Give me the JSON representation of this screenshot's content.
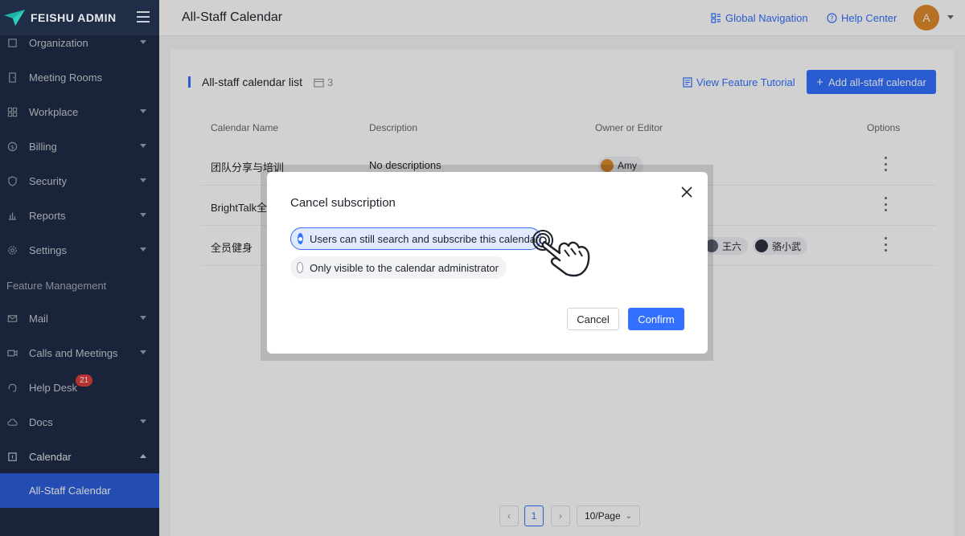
{
  "brand": {
    "name": "FEISHU ADMIN"
  },
  "sidebar": {
    "items": [
      {
        "label": "Organization",
        "icon": "org-icon",
        "expandable": true
      },
      {
        "label": "Meeting Rooms",
        "icon": "door-icon",
        "expandable": false
      },
      {
        "label": "Workplace",
        "icon": "grid-icon",
        "expandable": true
      },
      {
        "label": "Billing",
        "icon": "coin-icon",
        "expandable": true
      },
      {
        "label": "Security",
        "icon": "shield-icon",
        "expandable": true
      },
      {
        "label": "Reports",
        "icon": "bar-chart-icon",
        "expandable": true
      },
      {
        "label": "Settings",
        "icon": "gear-icon",
        "expandable": true
      }
    ],
    "section_label": "Feature Management",
    "feature_items": [
      {
        "label": "Mail",
        "icon": "mail-icon",
        "expandable": true
      },
      {
        "label": "Calls and Meetings",
        "icon": "video-icon",
        "expandable": true
      },
      {
        "label": "Help Desk",
        "icon": "headset-icon",
        "expandable": false,
        "badge": "21"
      },
      {
        "label": "Docs",
        "icon": "cloud-icon",
        "expandable": true
      },
      {
        "label": "Calendar",
        "icon": "calendar-icon",
        "expandable": true,
        "expanded": true
      }
    ],
    "active_subitem": "All-Staff Calendar"
  },
  "header": {
    "title": "All-Staff Calendar",
    "global_nav": "Global Navigation",
    "help_center": "Help Center",
    "avatar_initial": "A"
  },
  "list": {
    "title": "All-staff calendar list",
    "count": "3",
    "tutorial_link": "View Feature Tutorial",
    "add_button": "Add all-staff calendar",
    "columns": [
      "Calendar Name",
      "Description",
      "Owner or Editor",
      "Options"
    ],
    "rows": [
      {
        "name": "团队分享与培训",
        "description": "No descriptions",
        "owners": [
          "Amy"
        ]
      },
      {
        "name": "BrightTalk全",
        "description": "",
        "owners": []
      },
      {
        "name": "全员健身",
        "description": "",
        "owners": [
          "王六",
          "骆小武"
        ]
      }
    ]
  },
  "pagination": {
    "page": "1",
    "page_size": "10/Page"
  },
  "dialog": {
    "title": "Cancel subscription",
    "options": [
      {
        "label": "Users can still search and subscribe this calendar",
        "selected": true
      },
      {
        "label": "Only visible to the calendar administrator",
        "selected": false
      }
    ],
    "cancel": "Cancel",
    "confirm": "Confirm"
  },
  "colors": {
    "primary": "#3370ff",
    "sidebar_bg": "#1f2d47",
    "sidebar_active": "#2b5fd9",
    "badge": "#e23d3d",
    "avatar": "#e08a2c"
  }
}
